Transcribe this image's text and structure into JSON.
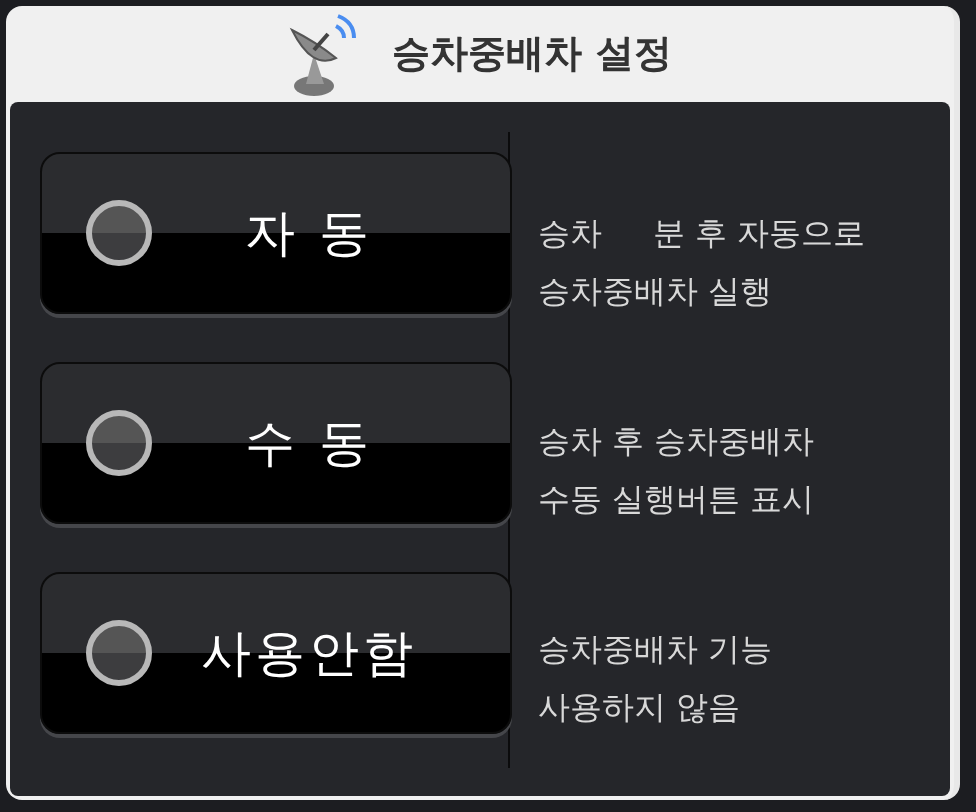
{
  "header": {
    "title": "승차중배차 설정"
  },
  "options": [
    {
      "label": "자 동",
      "selected": false,
      "description": [
        "승차     분 후 자동으로",
        "승차중배차 실행"
      ]
    },
    {
      "label": "수 동",
      "selected": false,
      "description": [
        "승차 후 승차중배차",
        "수동 실행버튼 표시"
      ]
    },
    {
      "label": "사용안함",
      "selected": false,
      "description": [
        "승차중배차 기능",
        "사용하지 않음"
      ]
    }
  ]
}
